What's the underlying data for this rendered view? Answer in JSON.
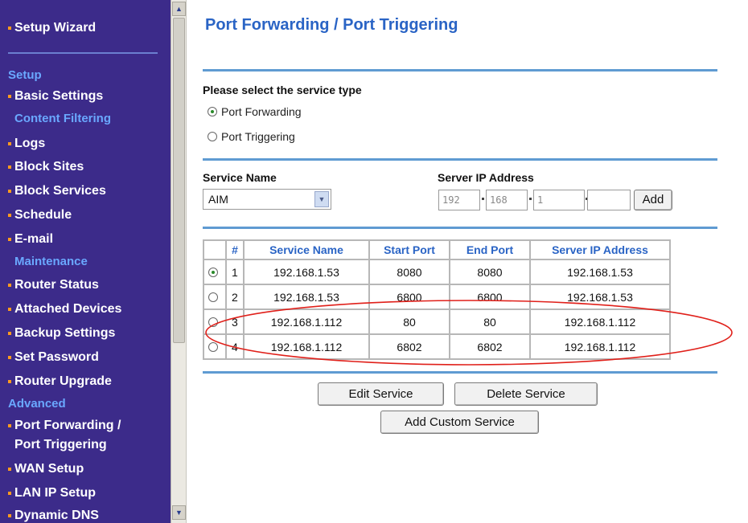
{
  "sidebar": {
    "setup_wizard": "Setup Wizard",
    "sections": {
      "setup": "Setup",
      "content_filtering": "Content Filtering",
      "maintenance": "Maintenance",
      "advanced": "Advanced"
    },
    "items": {
      "basic_settings": "Basic Settings",
      "logs": "Logs",
      "block_sites": "Block Sites",
      "block_services": "Block Services",
      "schedule": "Schedule",
      "email": "E-mail",
      "router_status": "Router Status",
      "attached_devices": "Attached Devices",
      "backup_settings": "Backup Settings",
      "set_password": "Set Password",
      "router_upgrade": "Router Upgrade",
      "port_forwarding_line1": "Port Forwarding /",
      "port_forwarding_line2": "Port Triggering",
      "wan_setup": "WAN Setup",
      "lan_ip_setup": "LAN IP Setup",
      "dynamic_dns": "Dynamic DNS"
    }
  },
  "main": {
    "title": "Port Forwarding / Port Triggering",
    "service_type_label": "Please select the service type",
    "options": {
      "port_forwarding": "Port Forwarding",
      "port_triggering": "Port Triggering",
      "selected": "port_forwarding"
    },
    "service_name_label": "Service Name",
    "service_name_value": "AIM",
    "server_ip_label": "Server IP Address",
    "ip": {
      "o1": "192",
      "o2": "168",
      "o3": "1",
      "o4": ""
    },
    "add_button": "Add",
    "table": {
      "headers": {
        "num": "#",
        "service_name": "Service Name",
        "start_port": "Start Port",
        "end_port": "End Port",
        "server_ip": "Server IP Address"
      },
      "rows": [
        {
          "num": "1",
          "service_name": "192.168.1.53",
          "start_port": "8080",
          "end_port": "8080",
          "server_ip": "192.168.1.53",
          "selected": true
        },
        {
          "num": "2",
          "service_name": "192.168.1.53",
          "start_port": "6800",
          "end_port": "6800",
          "server_ip": "192.168.1.53",
          "selected": false
        },
        {
          "num": "3",
          "service_name": "192.168.1.112",
          "start_port": "80",
          "end_port": "80",
          "server_ip": "192.168.1.112",
          "selected": false
        },
        {
          "num": "4",
          "service_name": "192.168.1.112",
          "start_port": "6802",
          "end_port": "6802",
          "server_ip": "192.168.1.112",
          "selected": false
        }
      ]
    },
    "buttons": {
      "edit": "Edit Service",
      "delete": "Delete Service",
      "add_custom": "Add Custom Service"
    }
  },
  "colors": {
    "sidebar_bg": "#3c2b8a",
    "section_text": "#6aa8ff",
    "title_blue": "#2a64c5",
    "rule_blue": "#5f9bd2",
    "annotation_red": "#e0201a"
  }
}
